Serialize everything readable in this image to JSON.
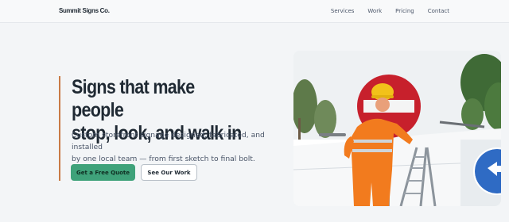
{
  "nav": {
    "brand": "Summit Signs Co.",
    "links": [
      "Services",
      "Work",
      "Pricing",
      "Contact"
    ]
  },
  "hero": {
    "headline_line1": "Signs that make people",
    "headline_line2": "stop, look, and walk in",
    "subhead_line1": "Custom storefront signage designed, fabricated, and installed",
    "subhead_line2": "by one local team — from first sketch to final bolt.",
    "primary_cta": "Get a Free Quote",
    "secondary_cta": "See Our Work"
  },
  "colors": {
    "accent_bar": "#c97a45",
    "primary_button": "#3fa27a",
    "page_bg": "#f3f5f7"
  }
}
